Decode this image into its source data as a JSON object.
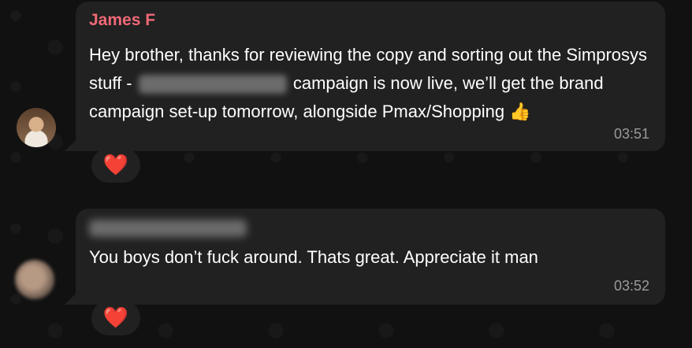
{
  "messages": [
    {
      "sender": "James F",
      "text_before": "Hey brother, thanks for reviewing the copy and sorting out the Simprosys stuff - ",
      "text_after": " campaign is now live, we’ll get the brand campaign set-up tomorrow, alongside Pmax/Shopping ",
      "emoji": "👍",
      "time": "03:51",
      "reaction": "❤️",
      "sender_color": "#f06877"
    },
    {
      "sender": "",
      "text": "You boys don’t fuck around. Thats great. Appreciate it man",
      "time": "03:52",
      "reaction": "❤️"
    }
  ],
  "colors": {
    "background": "#111111",
    "bubble": "#212121",
    "timestamp": "#9a9a9a",
    "heart": "#e8112d"
  }
}
